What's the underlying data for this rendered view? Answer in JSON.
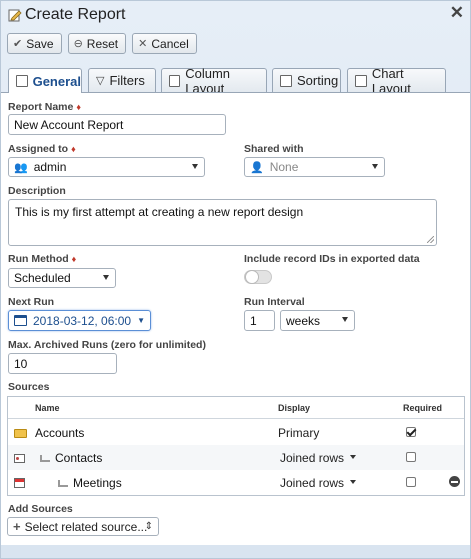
{
  "window": {
    "title": "Create Report"
  },
  "toolbar": {
    "save": "Save",
    "reset": "Reset",
    "cancel": "Cancel"
  },
  "tabs": [
    {
      "label": "General",
      "icon": "report-icon",
      "active": true
    },
    {
      "label": "Filters",
      "icon": "filter-icon"
    },
    {
      "label": "Column Layout",
      "icon": "columns-icon"
    },
    {
      "label": "Sorting",
      "icon": "sort-icon"
    },
    {
      "label": "Chart Layout",
      "icon": "chart-icon"
    }
  ],
  "general": {
    "report_name_label": "Report Name",
    "report_name_value": "New Account Report",
    "assigned_to_label": "Assigned to",
    "assigned_to_value": "admin",
    "shared_with_label": "Shared with",
    "shared_with_value": "None",
    "description_label": "Description",
    "description_value": "This is my first attempt at creating a new report design",
    "run_method_label": "Run Method",
    "run_method_value": "Scheduled",
    "include_ids_label": "Include record IDs in exported data",
    "include_ids_on": false,
    "next_run_label": "Next Run",
    "next_run_value": "2018-03-12, 06:00",
    "run_interval_label": "Run Interval",
    "run_interval_number": "1",
    "run_interval_unit": "weeks",
    "max_archived_label": "Max. Archived Runs (zero for unlimited)",
    "max_archived_value": "10",
    "required_marker": "♦"
  },
  "sources": {
    "label": "Sources",
    "columns": {
      "name": "Name",
      "display": "Display",
      "required": "Required"
    },
    "rows": [
      {
        "name": "Accounts",
        "display": "Primary",
        "required": true,
        "icon": "folder-icon"
      },
      {
        "name": "Contacts",
        "display": "Joined rows",
        "required": false,
        "icon": "contact-card-icon"
      },
      {
        "name": "Meetings",
        "display": "Joined rows",
        "required": false,
        "icon": "calendar-icon"
      }
    ]
  },
  "add_sources": {
    "label": "Add Sources",
    "select_placeholder": "Select related source..."
  },
  "colors": {
    "accent": "#1d4f8e",
    "required": "#c0392b",
    "focus": "#5b8fd6"
  }
}
